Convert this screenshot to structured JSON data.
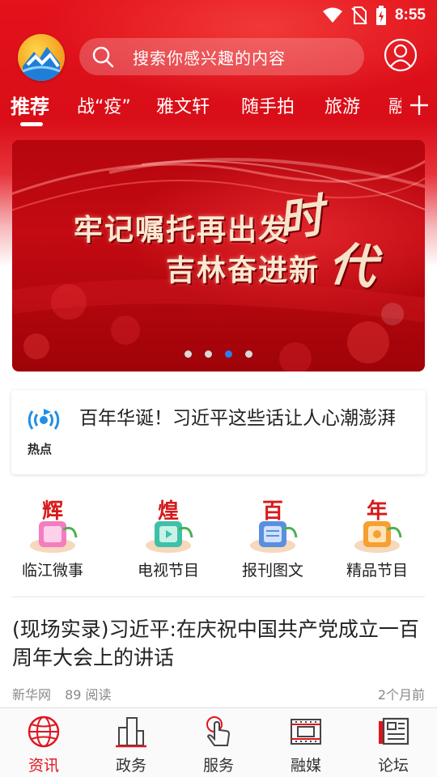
{
  "status_bar": {
    "time": "8:55"
  },
  "header": {
    "search_placeholder": "搜索你感兴趣的内容",
    "tabs": [
      "推荐",
      "战“疫”",
      "雅文轩",
      "随手拍",
      "旅游",
      "融"
    ],
    "active_tab": "推荐",
    "accent_color": "#e0141e"
  },
  "banner": {
    "line1": "牢记嘱托再出发",
    "line2": "吉林奋进新",
    "big_char1": "时",
    "big_char2": "代",
    "slide_count": 4,
    "active_slide": 3
  },
  "hot_news": {
    "label": "热点",
    "text": "百年华诞！习近平这些话让人心潮澎湃"
  },
  "channels": [
    {
      "label": "临江微事",
      "icon": "hui-badge-icon"
    },
    {
      "label": "电视节目",
      "icon": "huang-badge-icon"
    },
    {
      "label": "报刊图文",
      "icon": "bai-badge-icon"
    },
    {
      "label": "精品节目",
      "icon": "nian-badge-icon"
    }
  ],
  "article": {
    "title": "(现场实录)习近平:在庆祝中国共产党成立一百周年大会上的讲话",
    "source": "新华网",
    "reads": "89 阅读",
    "time": "2个月前"
  },
  "bottom_nav": [
    {
      "label": "资讯",
      "icon": "globe-icon",
      "active": true
    },
    {
      "label": "政务",
      "icon": "buildings-icon",
      "active": false
    },
    {
      "label": "服务",
      "icon": "hand-tap-icon",
      "active": false
    },
    {
      "label": "融媒",
      "icon": "film-icon",
      "active": false
    },
    {
      "label": "论坛",
      "icon": "newspaper-icon",
      "active": false
    }
  ]
}
